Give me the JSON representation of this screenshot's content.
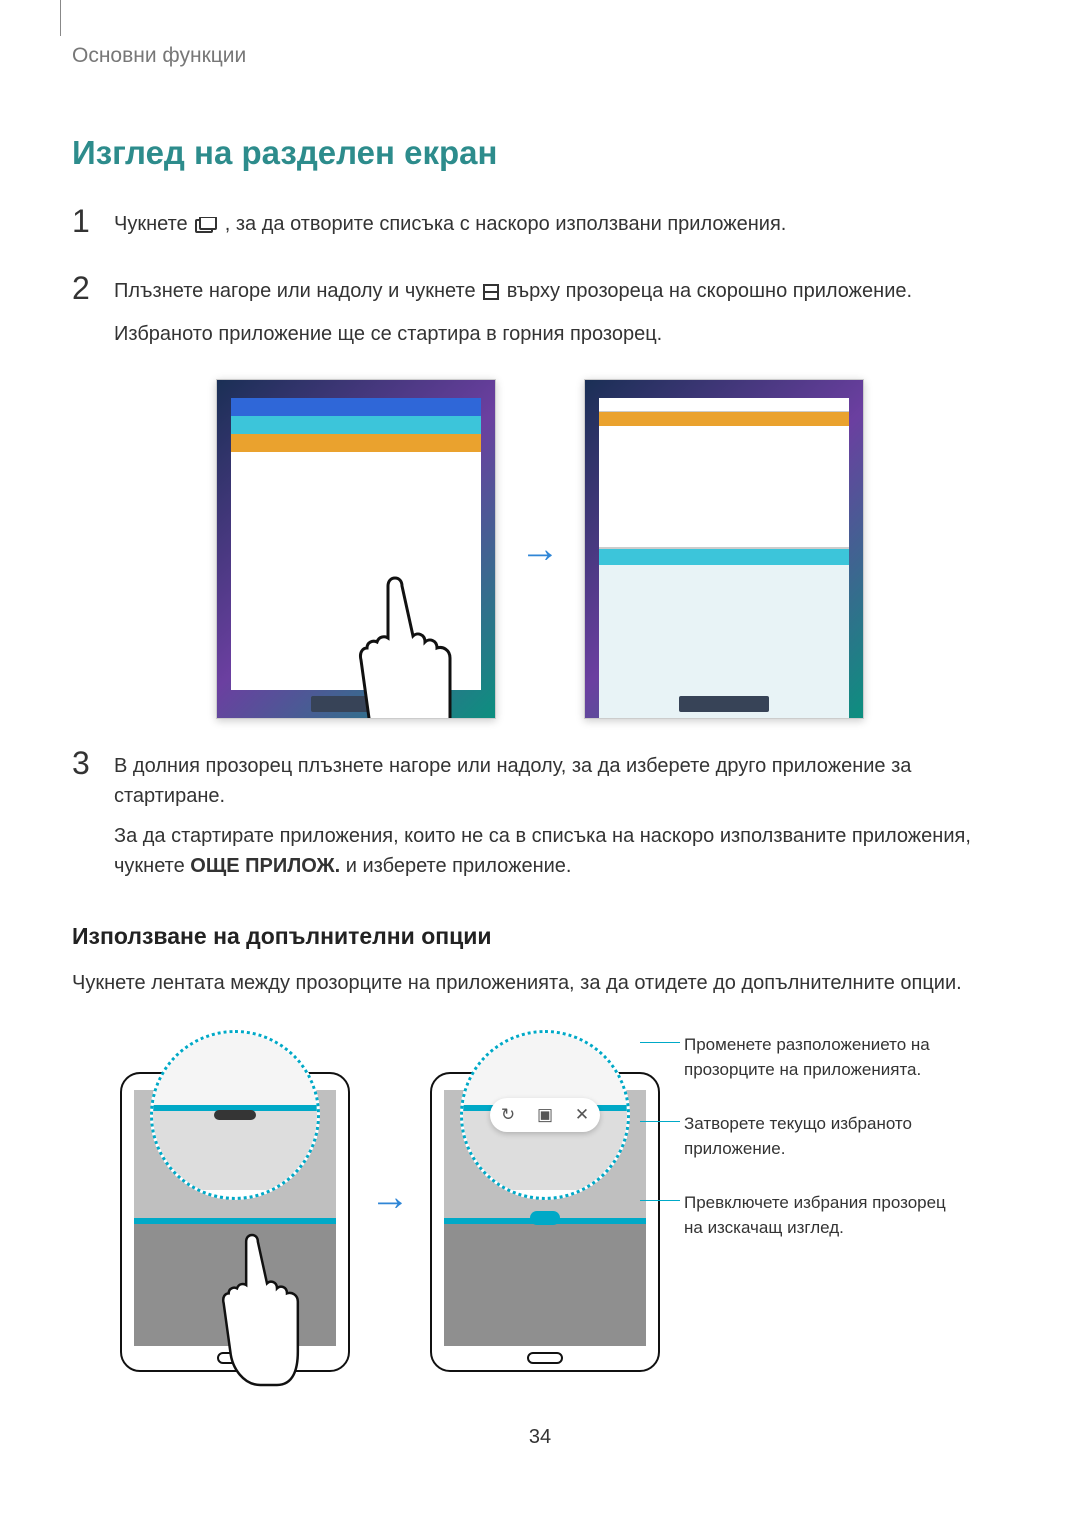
{
  "header": {
    "breadcrumb": "Основни функции"
  },
  "title": "Изглед на разделен екран",
  "steps": {
    "s1": {
      "num": "1",
      "before_icon": "Чукнете ",
      "after_icon": ", за да отворите списъка с наскоро използвани приложения."
    },
    "s2": {
      "num": "2",
      "line1_before": "Плъзнете нагоре или надолу и чукнете ",
      "line1_after": " върху прозореца на скорошно приложение.",
      "line2": "Избраното приложение ще се стартира в горния прозорец."
    },
    "s3": {
      "num": "3",
      "line1": "В долния прозорец плъзнете нагоре или надолу, за да изберете друго приложение за стартиране.",
      "line2_before": "За да стартирате приложения, които не са в списъка на наскоро използваните приложения, чукнете ",
      "line2_bold": "ОЩЕ ПРИЛОЖ.",
      "line2_after": " и изберете приложение."
    },
    "icons": {
      "recent": "recent-apps-icon",
      "split": "split-window-icon"
    }
  },
  "subsection": {
    "heading": "Използване на допълнителни опции",
    "body": "Чукнете лентата между прозорците на приложенията, за да отидете до допълнителните опции."
  },
  "callouts": {
    "c1": "Променете разположението на прозорците на приложенията.",
    "c2": "Затворете текущо избраното приложение.",
    "c3": "Превключете избрания прозорец на изскачащ изглед."
  },
  "toolbar_icons": {
    "swap": "↻",
    "popup": "▣",
    "close": "✕"
  },
  "page_number": "34"
}
